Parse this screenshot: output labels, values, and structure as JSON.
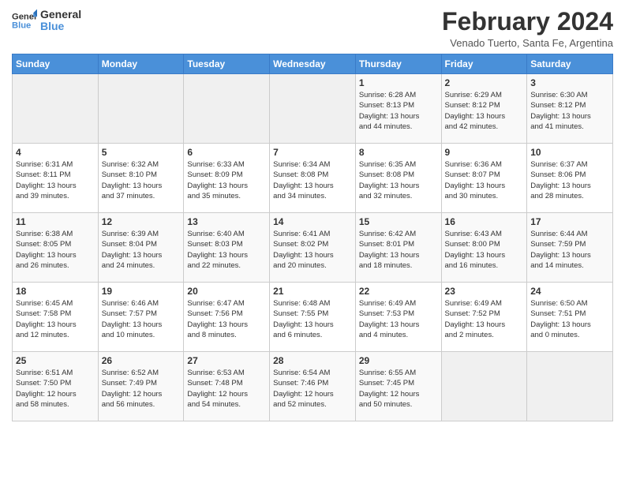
{
  "logo": {
    "line1": "General",
    "line2": "Blue"
  },
  "title": "February 2024",
  "subtitle": "Venado Tuerto, Santa Fe, Argentina",
  "days_of_week": [
    "Sunday",
    "Monday",
    "Tuesday",
    "Wednesday",
    "Thursday",
    "Friday",
    "Saturday"
  ],
  "weeks": [
    [
      {
        "day": "",
        "info": ""
      },
      {
        "day": "",
        "info": ""
      },
      {
        "day": "",
        "info": ""
      },
      {
        "day": "",
        "info": ""
      },
      {
        "day": "1",
        "info": "Sunrise: 6:28 AM\nSunset: 8:13 PM\nDaylight: 13 hours\nand 44 minutes."
      },
      {
        "day": "2",
        "info": "Sunrise: 6:29 AM\nSunset: 8:12 PM\nDaylight: 13 hours\nand 42 minutes."
      },
      {
        "day": "3",
        "info": "Sunrise: 6:30 AM\nSunset: 8:12 PM\nDaylight: 13 hours\nand 41 minutes."
      }
    ],
    [
      {
        "day": "4",
        "info": "Sunrise: 6:31 AM\nSunset: 8:11 PM\nDaylight: 13 hours\nand 39 minutes."
      },
      {
        "day": "5",
        "info": "Sunrise: 6:32 AM\nSunset: 8:10 PM\nDaylight: 13 hours\nand 37 minutes."
      },
      {
        "day": "6",
        "info": "Sunrise: 6:33 AM\nSunset: 8:09 PM\nDaylight: 13 hours\nand 35 minutes."
      },
      {
        "day": "7",
        "info": "Sunrise: 6:34 AM\nSunset: 8:08 PM\nDaylight: 13 hours\nand 34 minutes."
      },
      {
        "day": "8",
        "info": "Sunrise: 6:35 AM\nSunset: 8:08 PM\nDaylight: 13 hours\nand 32 minutes."
      },
      {
        "day": "9",
        "info": "Sunrise: 6:36 AM\nSunset: 8:07 PM\nDaylight: 13 hours\nand 30 minutes."
      },
      {
        "day": "10",
        "info": "Sunrise: 6:37 AM\nSunset: 8:06 PM\nDaylight: 13 hours\nand 28 minutes."
      }
    ],
    [
      {
        "day": "11",
        "info": "Sunrise: 6:38 AM\nSunset: 8:05 PM\nDaylight: 13 hours\nand 26 minutes."
      },
      {
        "day": "12",
        "info": "Sunrise: 6:39 AM\nSunset: 8:04 PM\nDaylight: 13 hours\nand 24 minutes."
      },
      {
        "day": "13",
        "info": "Sunrise: 6:40 AM\nSunset: 8:03 PM\nDaylight: 13 hours\nand 22 minutes."
      },
      {
        "day": "14",
        "info": "Sunrise: 6:41 AM\nSunset: 8:02 PM\nDaylight: 13 hours\nand 20 minutes."
      },
      {
        "day": "15",
        "info": "Sunrise: 6:42 AM\nSunset: 8:01 PM\nDaylight: 13 hours\nand 18 minutes."
      },
      {
        "day": "16",
        "info": "Sunrise: 6:43 AM\nSunset: 8:00 PM\nDaylight: 13 hours\nand 16 minutes."
      },
      {
        "day": "17",
        "info": "Sunrise: 6:44 AM\nSunset: 7:59 PM\nDaylight: 13 hours\nand 14 minutes."
      }
    ],
    [
      {
        "day": "18",
        "info": "Sunrise: 6:45 AM\nSunset: 7:58 PM\nDaylight: 13 hours\nand 12 minutes."
      },
      {
        "day": "19",
        "info": "Sunrise: 6:46 AM\nSunset: 7:57 PM\nDaylight: 13 hours\nand 10 minutes."
      },
      {
        "day": "20",
        "info": "Sunrise: 6:47 AM\nSunset: 7:56 PM\nDaylight: 13 hours\nand 8 minutes."
      },
      {
        "day": "21",
        "info": "Sunrise: 6:48 AM\nSunset: 7:55 PM\nDaylight: 13 hours\nand 6 minutes."
      },
      {
        "day": "22",
        "info": "Sunrise: 6:49 AM\nSunset: 7:53 PM\nDaylight: 13 hours\nand 4 minutes."
      },
      {
        "day": "23",
        "info": "Sunrise: 6:49 AM\nSunset: 7:52 PM\nDaylight: 13 hours\nand 2 minutes."
      },
      {
        "day": "24",
        "info": "Sunrise: 6:50 AM\nSunset: 7:51 PM\nDaylight: 13 hours\nand 0 minutes."
      }
    ],
    [
      {
        "day": "25",
        "info": "Sunrise: 6:51 AM\nSunset: 7:50 PM\nDaylight: 12 hours\nand 58 minutes."
      },
      {
        "day": "26",
        "info": "Sunrise: 6:52 AM\nSunset: 7:49 PM\nDaylight: 12 hours\nand 56 minutes."
      },
      {
        "day": "27",
        "info": "Sunrise: 6:53 AM\nSunset: 7:48 PM\nDaylight: 12 hours\nand 54 minutes."
      },
      {
        "day": "28",
        "info": "Sunrise: 6:54 AM\nSunset: 7:46 PM\nDaylight: 12 hours\nand 52 minutes."
      },
      {
        "day": "29",
        "info": "Sunrise: 6:55 AM\nSunset: 7:45 PM\nDaylight: 12 hours\nand 50 minutes."
      },
      {
        "day": "",
        "info": ""
      },
      {
        "day": "",
        "info": ""
      }
    ]
  ]
}
